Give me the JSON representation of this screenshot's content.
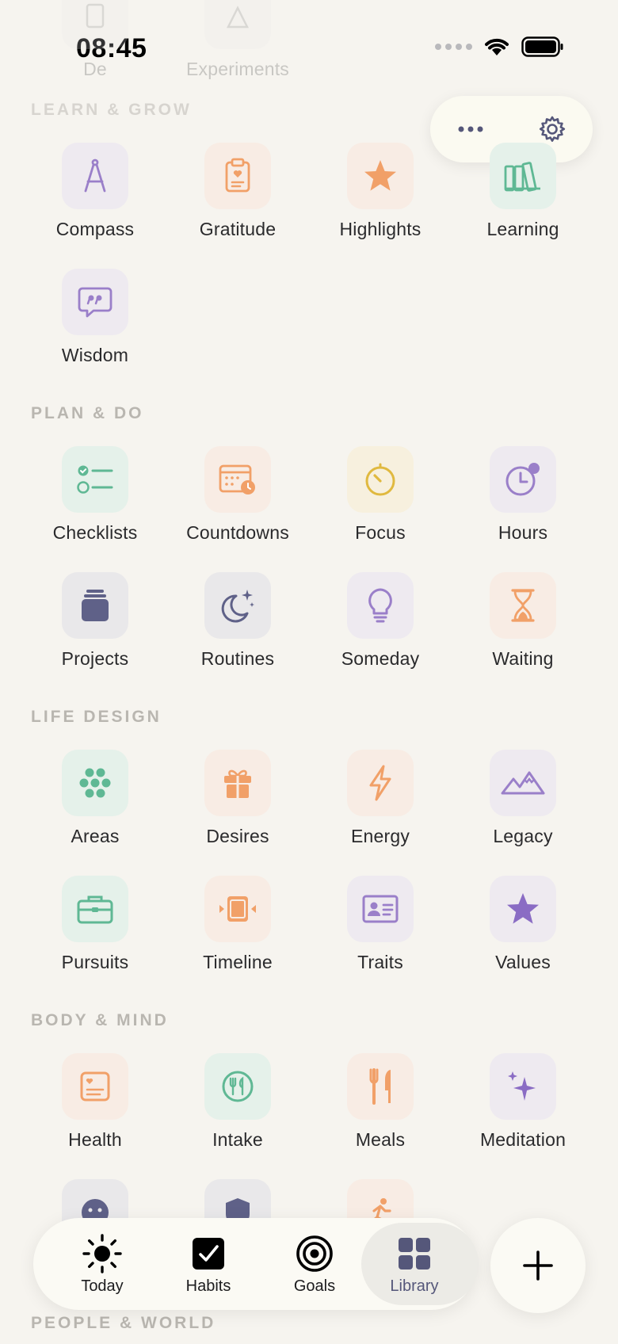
{
  "status_bar": {
    "time": "08:45"
  },
  "top_faded": {
    "items": [
      {
        "label": "De"
      },
      {
        "label": "Experiments"
      }
    ]
  },
  "sections": {
    "learn_grow": {
      "title": "LEARN & GROW",
      "items": [
        {
          "label": "Compass"
        },
        {
          "label": "Gratitude"
        },
        {
          "label": "Highlights"
        },
        {
          "label": "Learning"
        },
        {
          "label": "Wisdom"
        }
      ]
    },
    "plan_do": {
      "title": "PLAN & DO",
      "items": [
        {
          "label": "Checklists"
        },
        {
          "label": "Countdowns"
        },
        {
          "label": "Focus"
        },
        {
          "label": "Hours"
        },
        {
          "label": "Projects"
        },
        {
          "label": "Routines"
        },
        {
          "label": "Someday"
        },
        {
          "label": "Waiting"
        }
      ]
    },
    "life_design": {
      "title": "LIFE DESIGN",
      "items": [
        {
          "label": "Areas"
        },
        {
          "label": "Desires"
        },
        {
          "label": "Energy"
        },
        {
          "label": "Legacy"
        },
        {
          "label": "Pursuits"
        },
        {
          "label": "Timeline"
        },
        {
          "label": "Traits"
        },
        {
          "label": "Values"
        }
      ]
    },
    "body_mind": {
      "title": "BODY & MIND",
      "items": [
        {
          "label": "Health"
        },
        {
          "label": "Intake"
        },
        {
          "label": "Meals"
        },
        {
          "label": "Meditation"
        }
      ]
    },
    "people_world": {
      "title": "PEOPLE & WORLD"
    }
  },
  "tabbar": {
    "tabs": [
      {
        "label": "Today",
        "icon": "sun-icon"
      },
      {
        "label": "Habits",
        "icon": "checkbox-icon"
      },
      {
        "label": "Goals",
        "icon": "target-icon"
      },
      {
        "label": "Library",
        "icon": "grid-icon"
      }
    ],
    "active": "Library"
  },
  "colors": {
    "purple": "#9a7fc9",
    "orange": "#f1a068",
    "green": "#5fb894",
    "yellow": "#e0b93f",
    "slate": "#5f6188"
  }
}
